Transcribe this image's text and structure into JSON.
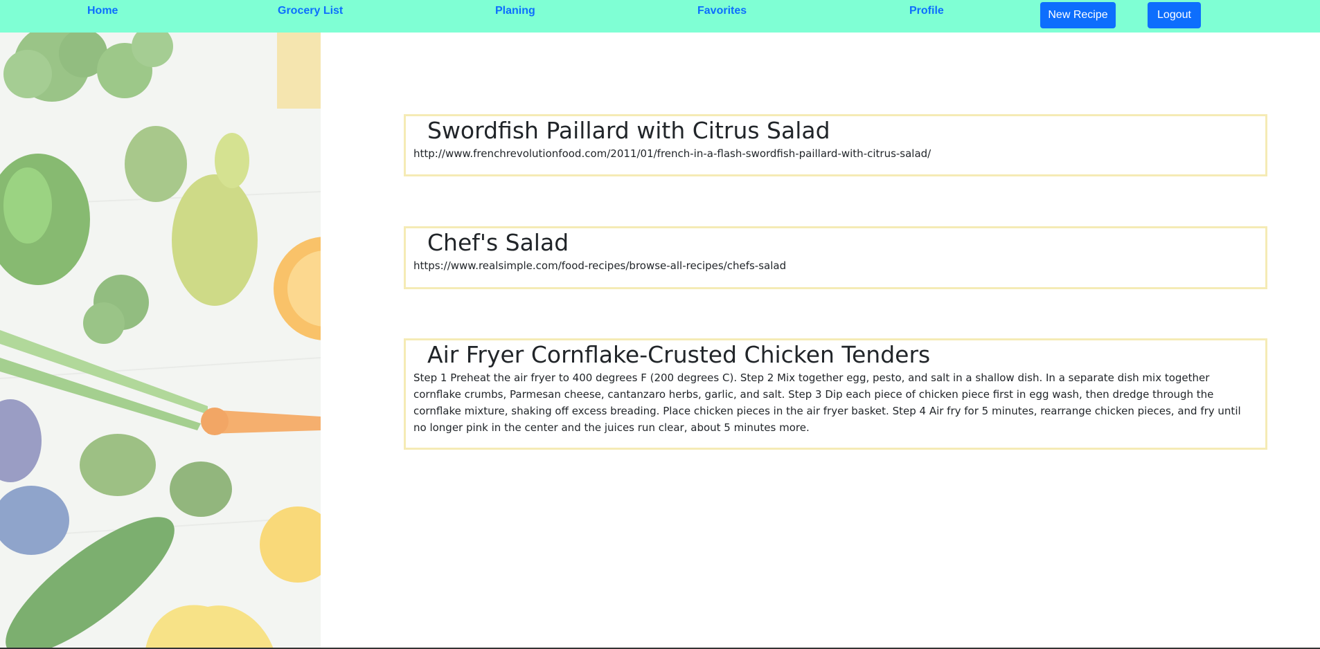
{
  "nav": {
    "links": [
      "Home",
      "Grocery List",
      "Planing",
      "Favorites",
      "Profile"
    ],
    "new_recipe": "New Recipe",
    "logout": "Logout"
  },
  "colors": {
    "navbar_bg": "#7fffd4",
    "link": "#0d6efd",
    "button_bg": "#0d6efd",
    "card_border": "#f5ebb5"
  },
  "recipes": [
    {
      "title": "Swordfish Paillard with Citrus Salad",
      "body": "http://www.frenchrevolutionfood.com/2011/01/french-in-a-flash-swordfish-paillard-with-citrus-salad/"
    },
    {
      "title": "Chef's Salad",
      "body": "https://www.realsimple.com/food-recipes/browse-all-recipes/chefs-salad"
    },
    {
      "title": "Air Fryer Cornflake-Crusted Chicken Tenders",
      "body": "Step 1 Preheat the air fryer to 400 degrees F (200 degrees C). Step 2 Mix together egg, pesto, and salt in a shallow dish. In a separate dish mix together cornflake crumbs, Parmesan cheese, cantanzaro herbs, garlic, and salt. Step 3 Dip each piece of chicken piece first in egg wash, then dredge through the cornflake mixture, shaking off excess breading. Place chicken pieces in the air fryer basket. Step 4 Air fry for 5 minutes, rearrange chicken pieces, and fry until no longer pink in the center and the juices run clear, about 5 minutes more."
    }
  ]
}
